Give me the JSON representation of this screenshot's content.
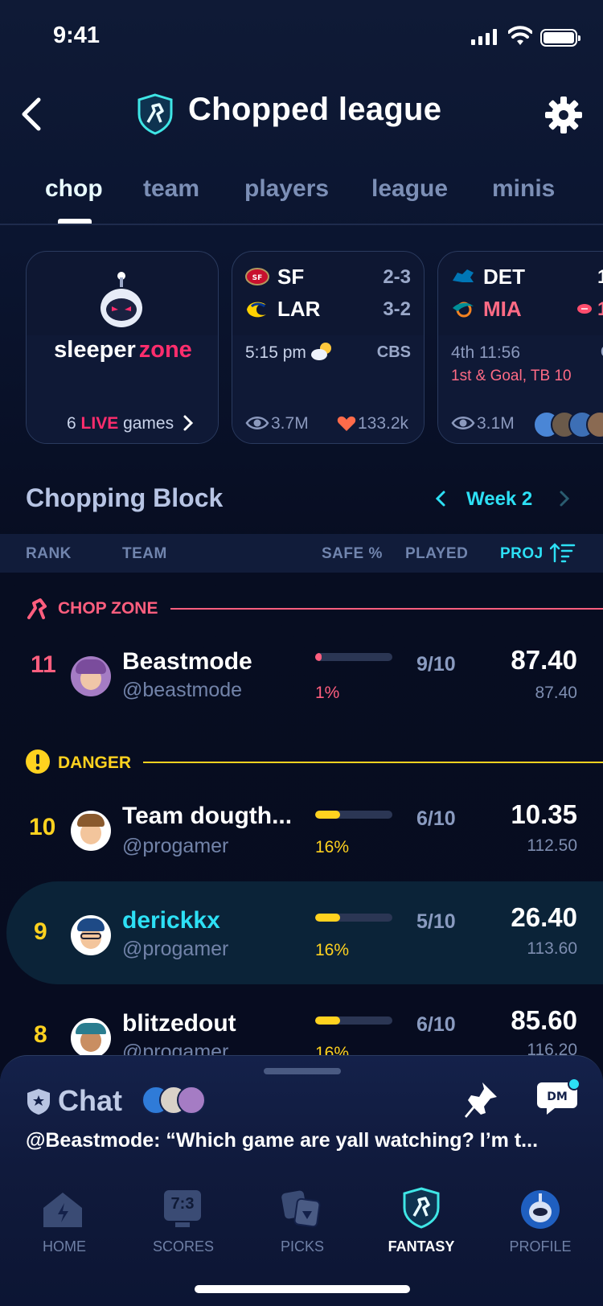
{
  "status_bar": {
    "time": "9:41"
  },
  "header": {
    "title": "Chopped league"
  },
  "tabs": [
    {
      "label": "chop",
      "active": true
    },
    {
      "label": "team",
      "active": false
    },
    {
      "label": "players",
      "active": false
    },
    {
      "label": "league",
      "active": false
    },
    {
      "label": "minis",
      "active": false
    }
  ],
  "sleeper_zone": {
    "brand_a": "sleeper",
    "brand_b": "zone",
    "count": "6",
    "live": "LIVE",
    "suffix": "games"
  },
  "games": [
    {
      "team1": "SF",
      "score1": "2-3",
      "team2": "LAR",
      "score2": "3-2",
      "time": "5:15 pm",
      "network": "CBS",
      "views": "3.7M",
      "likes": "133.2k"
    },
    {
      "team1": "DET",
      "score1": "1",
      "team2": "MIA",
      "score2": "1",
      "time": "4th 11:56",
      "network": "CB",
      "situation": "1st & Goal, TB 10",
      "views": "3.1M"
    }
  ],
  "chopping_block": {
    "title": "Chopping Block",
    "week": "Week 2",
    "columns": {
      "rank": "RANK",
      "team": "TEAM",
      "safe": "SAFE %",
      "played": "PLAYED",
      "proj": "PROJ"
    },
    "zones": {
      "chop": "CHOP ZONE",
      "danger": "DANGER"
    },
    "rows": [
      {
        "rank": "11",
        "name": "Beastmode",
        "handle": "@beastmode",
        "safe_pct": "1%",
        "safe_value": 0.01,
        "played": "9/10",
        "proj": "87.40",
        "proj2": "87.40"
      },
      {
        "rank": "10",
        "name": "Team dougth...",
        "handle": "@progamer",
        "safe_pct": "16%",
        "safe_value": 0.16,
        "played": "6/10",
        "proj": "10.35",
        "proj2": "112.50"
      },
      {
        "rank": "9",
        "name": "derickkx",
        "handle": "@progamer",
        "safe_pct": "16%",
        "safe_value": 0.16,
        "played": "5/10",
        "proj": "26.40",
        "proj2": "113.60"
      },
      {
        "rank": "8",
        "name": "blitzedout",
        "handle": "@progamer",
        "safe_pct": "16%",
        "safe_value": 0.16,
        "played": "6/10",
        "proj": "85.60",
        "proj2": "116.20"
      }
    ]
  },
  "chat": {
    "title": "Chat",
    "dm": "DM",
    "message": "@Beastmode: “Which game are yall watching? I’m t..."
  },
  "nav": [
    {
      "label": "HOME",
      "icon": "home-icon"
    },
    {
      "label": "SCORES",
      "icon": "scoreboard-icon",
      "badge": "7:3"
    },
    {
      "label": "PICKS",
      "icon": "picks-icon"
    },
    {
      "label": "FANTASY",
      "icon": "fantasy-shield-icon",
      "active": true
    },
    {
      "label": "PROFILE",
      "icon": "profile-avatar-icon"
    }
  ],
  "colors": {
    "accent": "#2de0f5",
    "chop": "#ff5e7e",
    "danger": "#ffd21f",
    "live": "#ff2d6d"
  }
}
